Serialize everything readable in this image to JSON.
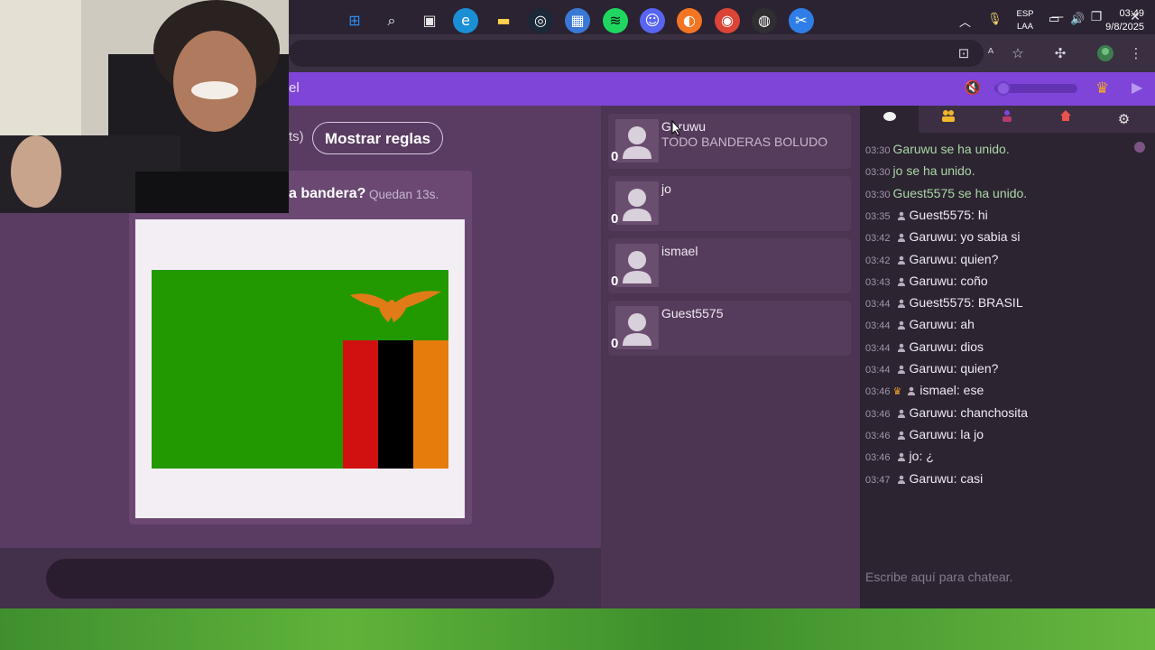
{
  "browser": {
    "title_bar_buttons": {
      "minimize": "—",
      "restore": "❐",
      "close": "✕"
    },
    "toolbar_icons": [
      "install-icon",
      "translate-icon",
      "star-icon",
      "extensions-icon",
      "profile-icon",
      "menu-icon"
    ]
  },
  "header": {
    "partial_text": "el",
    "icons": [
      "mute-icon",
      "crown-icon",
      "play-icon"
    ],
    "volume_fraction": 0.05
  },
  "game": {
    "rules_prefix": "ts)",
    "rules_button": "Mostrar reglas",
    "question": "a bandera?",
    "timer": "Quedan 13s.",
    "answer_placeholder": ""
  },
  "players": [
    {
      "name": "Garuwu",
      "message": "TODO BANDERAS BOLUDO",
      "score": "0"
    },
    {
      "name": "jo",
      "message": "",
      "score": "0"
    },
    {
      "name": "ismael",
      "message": "",
      "score": "0"
    },
    {
      "name": "Guest5575",
      "message": "",
      "score": "0"
    }
  ],
  "chat": {
    "tabs": [
      "chat-tab",
      "players-tab",
      "user-tab",
      "room-tab",
      "settings-tab"
    ],
    "messages": [
      {
        "time": "03:30",
        "text": "Garuwu se ha unido.",
        "type": "system"
      },
      {
        "time": "03:30",
        "text": "jo se ha unido.",
        "type": "system"
      },
      {
        "time": "03:30",
        "text": "Guest5575 se ha unido.",
        "type": "system"
      },
      {
        "time": "03:35",
        "user": "Guest5575",
        "text": "hi",
        "type": "user"
      },
      {
        "time": "03:42",
        "user": "Garuwu",
        "text": "yo sabia si",
        "type": "user"
      },
      {
        "time": "03:42",
        "user": "Garuwu",
        "text": "quien?",
        "type": "user"
      },
      {
        "time": "03:43",
        "user": "Garuwu",
        "text": "coño",
        "type": "user"
      },
      {
        "time": "03:44",
        "user": "Guest5575",
        "text": "BRASIL",
        "type": "user"
      },
      {
        "time": "03:44",
        "user": "Garuwu",
        "text": "ah",
        "type": "user"
      },
      {
        "time": "03:44",
        "user": "Garuwu",
        "text": "dios",
        "type": "user"
      },
      {
        "time": "03:44",
        "user": "Garuwu",
        "text": "quien?",
        "type": "user"
      },
      {
        "time": "03:46",
        "user": "ismael",
        "text": "ese",
        "type": "owner"
      },
      {
        "time": "03:46",
        "user": "Garuwu",
        "text": "chanchosita",
        "type": "user"
      },
      {
        "time": "03:46",
        "user": "Garuwu",
        "text": "la jo",
        "type": "user"
      },
      {
        "time": "03:46",
        "user": "jo",
        "text": "¿",
        "type": "user"
      },
      {
        "time": "03:47",
        "user": "Garuwu",
        "text": "casi",
        "type": "user"
      }
    ],
    "input_placeholder": "Escribe aquí para chatear."
  },
  "taskbar": {
    "apps": [
      "windows-start-icon",
      "search-icon",
      "task-view-icon",
      "edge-icon",
      "file-explorer-icon",
      "steam-icon",
      "microsoft-store-icon",
      "spotify-icon",
      "discord-icon",
      "crunchyroll-icon",
      "chrome-icon",
      "obs-icon",
      "snipping-tool-icon"
    ],
    "lang_line1": "ESP",
    "lang_line2": "LAA",
    "time": "03:49",
    "date": "9/8/2025"
  },
  "colors": {
    "header": "#7f45d9",
    "game_bg": "#5a3b61",
    "chat_bg": "#2c2431",
    "flag_green": "#229900",
    "flag_red": "#d11010",
    "flag_black": "#000000",
    "flag_orange": "#e57c0c"
  }
}
